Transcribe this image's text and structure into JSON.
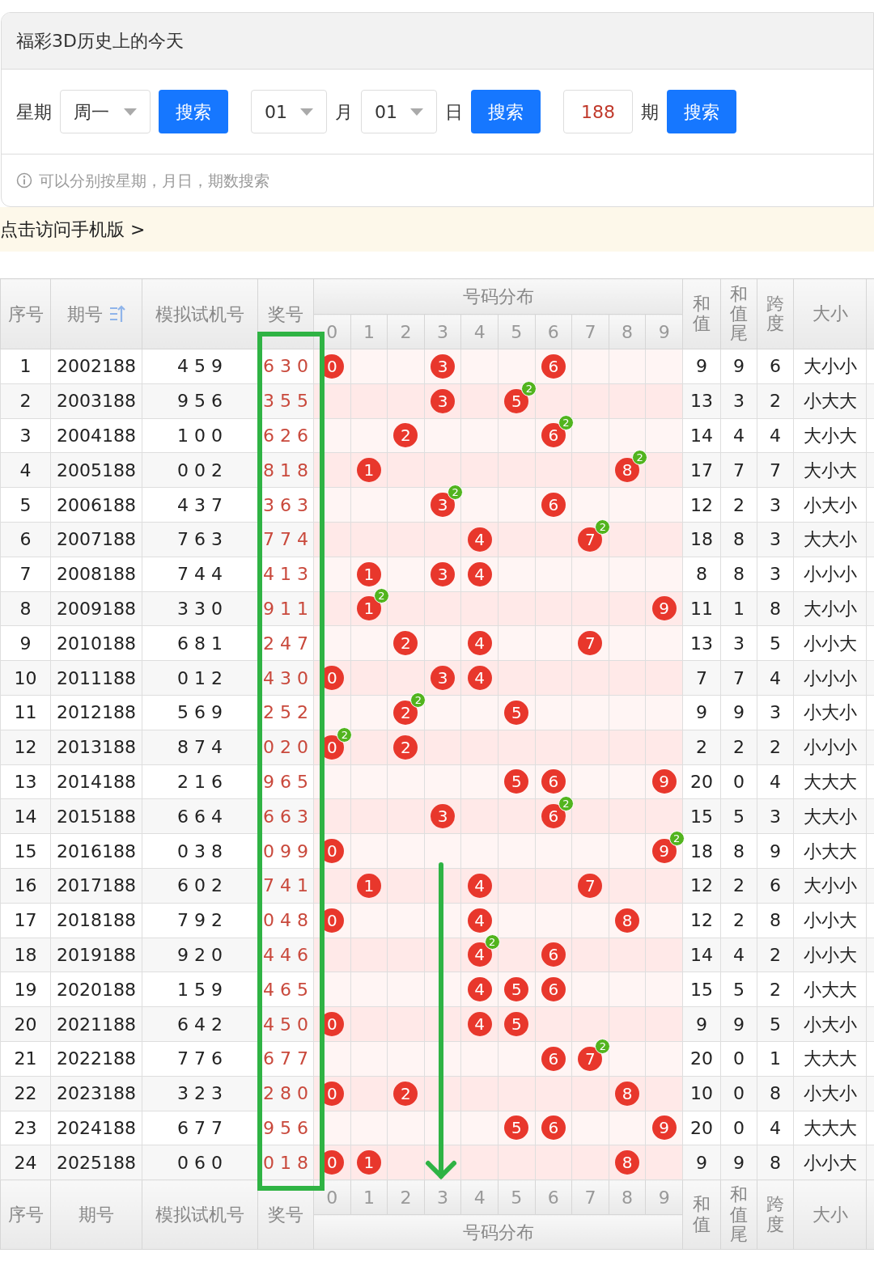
{
  "page_title": "福彩3D历史上的今天",
  "search": {
    "weekday_label": "星期",
    "weekday": "周一",
    "weekday_button": "搜索",
    "month": "01",
    "month_label": "月",
    "day": "01",
    "day_label": "日",
    "date_button": "搜索",
    "issue": "188",
    "issue_label": "期",
    "issue_button": "搜索"
  },
  "hint": "可以分别按星期，月日，期数搜索",
  "mobile_link": "点击访问手机版 >",
  "table": {
    "columns": [
      {
        "label": "序号",
        "sorted": false
      },
      {
        "label": "期号",
        "sorted": true
      },
      {
        "label": "模拟试机号",
        "sorted": false
      },
      {
        "label": "奖号",
        "sorted": false
      }
    ],
    "distribution_title": "号码分布",
    "digits": [
      "0",
      "1",
      "2",
      "3",
      "4",
      "5",
      "6",
      "7",
      "8",
      "9"
    ],
    "stat_columns": [
      {
        "label": "和值",
        "kind": "stacked"
      },
      {
        "label": "和值尾",
        "kind": "stacked"
      },
      {
        "label": "跨度",
        "kind": "stacked"
      },
      {
        "label": "大小",
        "kind": "flat"
      }
    ],
    "rows": [
      {
        "no": "1",
        "issue": "2002188",
        "trial": "4 5 9",
        "award": "6 3 0",
        "dist": [
          {
            "kind": "ball",
            "digit": "0"
          },
          {
            "kind": "empty"
          },
          {
            "kind": "empty"
          },
          {
            "kind": "ball",
            "digit": "3"
          },
          {
            "kind": "empty"
          },
          {
            "kind": "empty"
          },
          {
            "kind": "ball",
            "digit": "6"
          },
          {
            "kind": "empty"
          },
          {
            "kind": "empty"
          },
          {
            "kind": "empty"
          }
        ],
        "sum": "9",
        "sum_tail": "9",
        "span": "6",
        "size": "大小小"
      },
      {
        "no": "2",
        "issue": "2003188",
        "trial": "9 5 6",
        "award": "3 5 5",
        "dist": [
          {
            "kind": "empty"
          },
          {
            "kind": "empty"
          },
          {
            "kind": "empty"
          },
          {
            "kind": "ball",
            "digit": "3"
          },
          {
            "kind": "empty"
          },
          {
            "kind": "ball",
            "digit": "5",
            "repeat": "2"
          },
          {
            "kind": "empty"
          },
          {
            "kind": "empty"
          },
          {
            "kind": "empty"
          },
          {
            "kind": "empty"
          }
        ],
        "sum": "13",
        "sum_tail": "3",
        "span": "2",
        "size": "小大大"
      },
      {
        "no": "3",
        "issue": "2004188",
        "trial": "1 0 0",
        "award": "6 2 6",
        "dist": [
          {
            "kind": "empty"
          },
          {
            "kind": "empty"
          },
          {
            "kind": "ball",
            "digit": "2"
          },
          {
            "kind": "empty"
          },
          {
            "kind": "empty"
          },
          {
            "kind": "empty"
          },
          {
            "kind": "ball",
            "digit": "6",
            "repeat": "2"
          },
          {
            "kind": "empty"
          },
          {
            "kind": "empty"
          },
          {
            "kind": "empty"
          }
        ],
        "sum": "14",
        "sum_tail": "4",
        "span": "4",
        "size": "大小大"
      },
      {
        "no": "4",
        "issue": "2005188",
        "trial": "0 0 2",
        "award": "8 1 8",
        "dist": [
          {
            "kind": "empty"
          },
          {
            "kind": "ball",
            "digit": "1"
          },
          {
            "kind": "empty"
          },
          {
            "kind": "empty"
          },
          {
            "kind": "empty"
          },
          {
            "kind": "empty"
          },
          {
            "kind": "empty"
          },
          {
            "kind": "empty"
          },
          {
            "kind": "ball",
            "digit": "8",
            "repeat": "2"
          },
          {
            "kind": "empty"
          }
        ],
        "sum": "17",
        "sum_tail": "7",
        "span": "7",
        "size": "大小大"
      },
      {
        "no": "5",
        "issue": "2006188",
        "trial": "4 3 7",
        "award": "3 6 3",
        "dist": [
          {
            "kind": "empty"
          },
          {
            "kind": "empty"
          },
          {
            "kind": "empty"
          },
          {
            "kind": "ball",
            "digit": "3",
            "repeat": "2"
          },
          {
            "kind": "empty"
          },
          {
            "kind": "empty"
          },
          {
            "kind": "ball",
            "digit": "6"
          },
          {
            "kind": "empty"
          },
          {
            "kind": "empty"
          },
          {
            "kind": "empty"
          }
        ],
        "sum": "12",
        "sum_tail": "2",
        "span": "3",
        "size": "小大小"
      },
      {
        "no": "6",
        "issue": "2007188",
        "trial": "7 6 3",
        "award": "7 7 4",
        "dist": [
          {
            "kind": "empty"
          },
          {
            "kind": "empty"
          },
          {
            "kind": "empty"
          },
          {
            "kind": "empty"
          },
          {
            "kind": "ball",
            "digit": "4"
          },
          {
            "kind": "empty"
          },
          {
            "kind": "empty"
          },
          {
            "kind": "ball",
            "digit": "7",
            "repeat": "2"
          },
          {
            "kind": "empty"
          },
          {
            "kind": "empty"
          }
        ],
        "sum": "18",
        "sum_tail": "8",
        "span": "3",
        "size": "大大小"
      },
      {
        "no": "7",
        "issue": "2008188",
        "trial": "7 4 4",
        "award": "4 1 3",
        "dist": [
          {
            "kind": "empty"
          },
          {
            "kind": "ball",
            "digit": "1"
          },
          {
            "kind": "empty"
          },
          {
            "kind": "ball",
            "digit": "3"
          },
          {
            "kind": "ball",
            "digit": "4"
          },
          {
            "kind": "empty"
          },
          {
            "kind": "empty"
          },
          {
            "kind": "empty"
          },
          {
            "kind": "empty"
          },
          {
            "kind": "empty"
          }
        ],
        "sum": "8",
        "sum_tail": "8",
        "span": "3",
        "size": "小小小"
      },
      {
        "no": "8",
        "issue": "2009188",
        "trial": "3 3 0",
        "award": "9 1 1",
        "dist": [
          {
            "kind": "empty"
          },
          {
            "kind": "ball",
            "digit": "1",
            "repeat": "2"
          },
          {
            "kind": "empty"
          },
          {
            "kind": "empty"
          },
          {
            "kind": "empty"
          },
          {
            "kind": "empty"
          },
          {
            "kind": "empty"
          },
          {
            "kind": "empty"
          },
          {
            "kind": "empty"
          },
          {
            "kind": "ball",
            "digit": "9"
          }
        ],
        "sum": "11",
        "sum_tail": "1",
        "span": "8",
        "size": "大小小"
      },
      {
        "no": "9",
        "issue": "2010188",
        "trial": "6 8 1",
        "award": "2 4 7",
        "dist": [
          {
            "kind": "empty"
          },
          {
            "kind": "empty"
          },
          {
            "kind": "ball",
            "digit": "2"
          },
          {
            "kind": "empty"
          },
          {
            "kind": "ball",
            "digit": "4"
          },
          {
            "kind": "empty"
          },
          {
            "kind": "empty"
          },
          {
            "kind": "ball",
            "digit": "7"
          },
          {
            "kind": "empty"
          },
          {
            "kind": "empty"
          }
        ],
        "sum": "13",
        "sum_tail": "3",
        "span": "5",
        "size": "小小大"
      },
      {
        "no": "10",
        "issue": "2011188",
        "trial": "0 1 2",
        "award": "4 3 0",
        "dist": [
          {
            "kind": "ball",
            "digit": "0"
          },
          {
            "kind": "empty"
          },
          {
            "kind": "empty"
          },
          {
            "kind": "ball",
            "digit": "3"
          },
          {
            "kind": "ball",
            "digit": "4"
          },
          {
            "kind": "empty"
          },
          {
            "kind": "empty"
          },
          {
            "kind": "empty"
          },
          {
            "kind": "empty"
          },
          {
            "kind": "empty"
          }
        ],
        "sum": "7",
        "sum_tail": "7",
        "span": "4",
        "size": "小小小"
      },
      {
        "no": "11",
        "issue": "2012188",
        "trial": "5 6 9",
        "award": "2 5 2",
        "dist": [
          {
            "kind": "empty"
          },
          {
            "kind": "empty"
          },
          {
            "kind": "ball",
            "digit": "2",
            "repeat": "2"
          },
          {
            "kind": "empty"
          },
          {
            "kind": "empty"
          },
          {
            "kind": "ball",
            "digit": "5"
          },
          {
            "kind": "empty"
          },
          {
            "kind": "empty"
          },
          {
            "kind": "empty"
          },
          {
            "kind": "empty"
          }
        ],
        "sum": "9",
        "sum_tail": "9",
        "span": "3",
        "size": "小大小"
      },
      {
        "no": "12",
        "issue": "2013188",
        "trial": "8 7 4",
        "award": "0 2 0",
        "dist": [
          {
            "kind": "ball",
            "digit": "0",
            "repeat": "2"
          },
          {
            "kind": "empty"
          },
          {
            "kind": "ball",
            "digit": "2"
          },
          {
            "kind": "empty"
          },
          {
            "kind": "empty"
          },
          {
            "kind": "empty"
          },
          {
            "kind": "empty"
          },
          {
            "kind": "empty"
          },
          {
            "kind": "empty"
          },
          {
            "kind": "empty"
          }
        ],
        "sum": "2",
        "sum_tail": "2",
        "span": "2",
        "size": "小小小"
      },
      {
        "no": "13",
        "issue": "2014188",
        "trial": "2 1 6",
        "award": "9 6 5",
        "dist": [
          {
            "kind": "empty"
          },
          {
            "kind": "empty"
          },
          {
            "kind": "empty"
          },
          {
            "kind": "empty"
          },
          {
            "kind": "empty"
          },
          {
            "kind": "ball",
            "digit": "5"
          },
          {
            "kind": "ball",
            "digit": "6"
          },
          {
            "kind": "empty"
          },
          {
            "kind": "empty"
          },
          {
            "kind": "ball",
            "digit": "9"
          }
        ],
        "sum": "20",
        "sum_tail": "0",
        "span": "4",
        "size": "大大大"
      },
      {
        "no": "14",
        "issue": "2015188",
        "trial": "6 6 4",
        "award": "6 6 3",
        "dist": [
          {
            "kind": "empty"
          },
          {
            "kind": "empty"
          },
          {
            "kind": "empty"
          },
          {
            "kind": "ball",
            "digit": "3"
          },
          {
            "kind": "empty"
          },
          {
            "kind": "empty"
          },
          {
            "kind": "ball",
            "digit": "6",
            "repeat": "2"
          },
          {
            "kind": "empty"
          },
          {
            "kind": "empty"
          },
          {
            "kind": "empty"
          }
        ],
        "sum": "15",
        "sum_tail": "5",
        "span": "3",
        "size": "大大小"
      },
      {
        "no": "15",
        "issue": "2016188",
        "trial": "0 3 8",
        "award": "0 9 9",
        "dist": [
          {
            "kind": "ball",
            "digit": "0"
          },
          {
            "kind": "empty"
          },
          {
            "kind": "empty"
          },
          {
            "kind": "empty"
          },
          {
            "kind": "empty"
          },
          {
            "kind": "empty"
          },
          {
            "kind": "empty"
          },
          {
            "kind": "empty"
          },
          {
            "kind": "empty"
          },
          {
            "kind": "ball",
            "digit": "9",
            "repeat": "2"
          }
        ],
        "sum": "18",
        "sum_tail": "8",
        "span": "9",
        "size": "小大大"
      },
      {
        "no": "16",
        "issue": "2017188",
        "trial": "6 0 2",
        "award": "7 4 1",
        "dist": [
          {
            "kind": "empty"
          },
          {
            "kind": "ball",
            "digit": "1"
          },
          {
            "kind": "empty"
          },
          {
            "kind": "empty"
          },
          {
            "kind": "ball",
            "digit": "4"
          },
          {
            "kind": "empty"
          },
          {
            "kind": "empty"
          },
          {
            "kind": "ball",
            "digit": "7"
          },
          {
            "kind": "empty"
          },
          {
            "kind": "empty"
          }
        ],
        "sum": "12",
        "sum_tail": "2",
        "span": "6",
        "size": "大小小"
      },
      {
        "no": "17",
        "issue": "2018188",
        "trial": "7 9 2",
        "award": "0 4 8",
        "dist": [
          {
            "kind": "ball",
            "digit": "0"
          },
          {
            "kind": "empty"
          },
          {
            "kind": "empty"
          },
          {
            "kind": "empty"
          },
          {
            "kind": "ball",
            "digit": "4"
          },
          {
            "kind": "empty"
          },
          {
            "kind": "empty"
          },
          {
            "kind": "empty"
          },
          {
            "kind": "ball",
            "digit": "8"
          },
          {
            "kind": "empty"
          }
        ],
        "sum": "12",
        "sum_tail": "2",
        "span": "8",
        "size": "小小大"
      },
      {
        "no": "18",
        "issue": "2019188",
        "trial": "9 2 0",
        "award": "4 4 6",
        "dist": [
          {
            "kind": "empty"
          },
          {
            "kind": "empty"
          },
          {
            "kind": "empty"
          },
          {
            "kind": "empty"
          },
          {
            "kind": "ball",
            "digit": "4",
            "repeat": "2"
          },
          {
            "kind": "empty"
          },
          {
            "kind": "ball",
            "digit": "6"
          },
          {
            "kind": "empty"
          },
          {
            "kind": "empty"
          },
          {
            "kind": "empty"
          }
        ],
        "sum": "14",
        "sum_tail": "4",
        "span": "2",
        "size": "小小大"
      },
      {
        "no": "19",
        "issue": "2020188",
        "trial": "1 5 9",
        "award": "4 6 5",
        "dist": [
          {
            "kind": "empty"
          },
          {
            "kind": "empty"
          },
          {
            "kind": "empty"
          },
          {
            "kind": "empty"
          },
          {
            "kind": "ball",
            "digit": "4"
          },
          {
            "kind": "ball",
            "digit": "5"
          },
          {
            "kind": "ball",
            "digit": "6"
          },
          {
            "kind": "empty"
          },
          {
            "kind": "empty"
          },
          {
            "kind": "empty"
          }
        ],
        "sum": "15",
        "sum_tail": "5",
        "span": "2",
        "size": "小大大"
      },
      {
        "no": "20",
        "issue": "2021188",
        "trial": "6 4 2",
        "award": "4 5 0",
        "dist": [
          {
            "kind": "ball",
            "digit": "0"
          },
          {
            "kind": "empty"
          },
          {
            "kind": "empty"
          },
          {
            "kind": "empty"
          },
          {
            "kind": "ball",
            "digit": "4"
          },
          {
            "kind": "ball",
            "digit": "5"
          },
          {
            "kind": "empty"
          },
          {
            "kind": "empty"
          },
          {
            "kind": "empty"
          },
          {
            "kind": "empty"
          }
        ],
        "sum": "9",
        "sum_tail": "9",
        "span": "5",
        "size": "小大小"
      },
      {
        "no": "21",
        "issue": "2022188",
        "trial": "7 7 6",
        "award": "6 7 7",
        "dist": [
          {
            "kind": "empty"
          },
          {
            "kind": "empty"
          },
          {
            "kind": "empty"
          },
          {
            "kind": "empty"
          },
          {
            "kind": "empty"
          },
          {
            "kind": "empty"
          },
          {
            "kind": "ball",
            "digit": "6"
          },
          {
            "kind": "ball",
            "digit": "7",
            "repeat": "2"
          },
          {
            "kind": "empty"
          },
          {
            "kind": "empty"
          }
        ],
        "sum": "20",
        "sum_tail": "0",
        "span": "1",
        "size": "大大大"
      },
      {
        "no": "22",
        "issue": "2023188",
        "trial": "3 2 3",
        "award": "2 8 0",
        "dist": [
          {
            "kind": "ball",
            "digit": "0"
          },
          {
            "kind": "empty"
          },
          {
            "kind": "ball",
            "digit": "2"
          },
          {
            "kind": "empty"
          },
          {
            "kind": "empty"
          },
          {
            "kind": "empty"
          },
          {
            "kind": "empty"
          },
          {
            "kind": "empty"
          },
          {
            "kind": "ball",
            "digit": "8"
          },
          {
            "kind": "empty"
          }
        ],
        "sum": "10",
        "sum_tail": "0",
        "span": "8",
        "size": "小大小"
      },
      {
        "no": "23",
        "issue": "2024188",
        "trial": "6 7 7",
        "award": "9 5 6",
        "dist": [
          {
            "kind": "empty"
          },
          {
            "kind": "empty"
          },
          {
            "kind": "empty"
          },
          {
            "kind": "empty"
          },
          {
            "kind": "empty"
          },
          {
            "kind": "ball",
            "digit": "5"
          },
          {
            "kind": "ball",
            "digit": "6"
          },
          {
            "kind": "empty"
          },
          {
            "kind": "empty"
          },
          {
            "kind": "ball",
            "digit": "9"
          }
        ],
        "sum": "20",
        "sum_tail": "0",
        "span": "4",
        "size": "大大大"
      },
      {
        "no": "24",
        "issue": "2025188",
        "trial": "0 6 0",
        "award": "0 1 8",
        "dist": [
          {
            "kind": "ball",
            "digit": "0"
          },
          {
            "kind": "ball",
            "digit": "1"
          },
          {
            "kind": "empty"
          },
          {
            "kind": "empty"
          },
          {
            "kind": "empty"
          },
          {
            "kind": "empty"
          },
          {
            "kind": "empty"
          },
          {
            "kind": "empty"
          },
          {
            "kind": "ball",
            "digit": "8"
          },
          {
            "kind": "empty"
          }
        ],
        "sum": "9",
        "sum_tail": "9",
        "span": "8",
        "size": "小小大"
      }
    ],
    "footer_columns": [
      "序号",
      "期号",
      "模拟试机号",
      "奖号"
    ],
    "footer_digits": [
      "0",
      "1",
      "2",
      "3",
      "4",
      "5",
      "6",
      "7",
      "8",
      "9"
    ],
    "footer_distribution_title": "号码分布",
    "footer_stat_columns": [
      {
        "label": "和值",
        "kind": "stacked"
      },
      {
        "label": "和值尾",
        "kind": "stacked"
      },
      {
        "label": "跨度",
        "kind": "stacked"
      },
      {
        "label": "大小",
        "kind": "flat"
      }
    ]
  }
}
